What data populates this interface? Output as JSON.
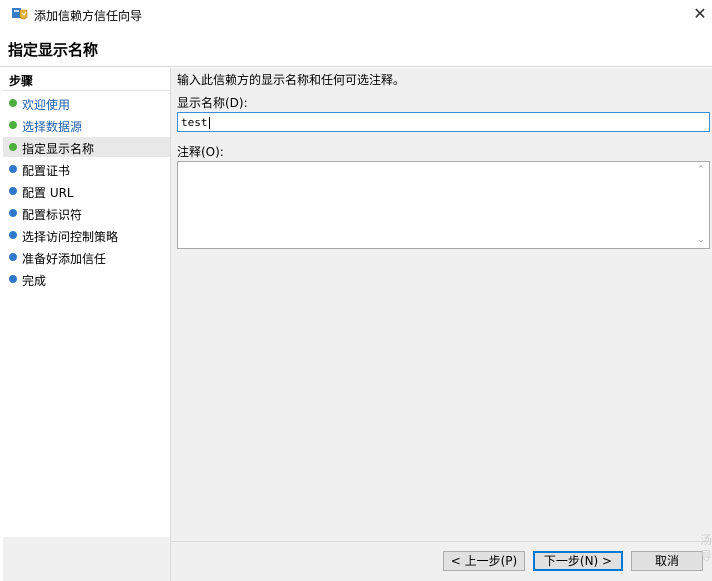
{
  "window": {
    "title": "添加信赖方信任向导",
    "close_label": "✕"
  },
  "header": {
    "page_title": "指定显示名称"
  },
  "sidebar": {
    "section_label": "步骤",
    "steps": [
      {
        "label": "欢迎使用",
        "state": "done"
      },
      {
        "label": "选择数据源",
        "state": "done"
      },
      {
        "label": "指定显示名称",
        "state": "current"
      },
      {
        "label": "配置证书",
        "state": "pending"
      },
      {
        "label": "配置 URL",
        "state": "pending"
      },
      {
        "label": "配置标识符",
        "state": "pending"
      },
      {
        "label": "选择访问控制策略",
        "state": "pending"
      },
      {
        "label": "准备好添加信任",
        "state": "pending"
      },
      {
        "label": "完成",
        "state": "pending"
      }
    ]
  },
  "main": {
    "description": "输入此信赖方的显示名称和任何可选注释。",
    "display_name_label": "显示名称(D):",
    "display_name_value": "test",
    "notes_label": "注释(O):",
    "notes_value": ""
  },
  "footer": {
    "back_label": "< 上一步(P)",
    "next_label": "下一步(N) >",
    "cancel_label": "取消"
  },
  "watermark": "汤导",
  "colors": {
    "done_dot": "#4cae3d",
    "pending_dot": "#2e78c7",
    "link_text": "#1f5fa8",
    "focus_border": "#3c8fd6"
  }
}
